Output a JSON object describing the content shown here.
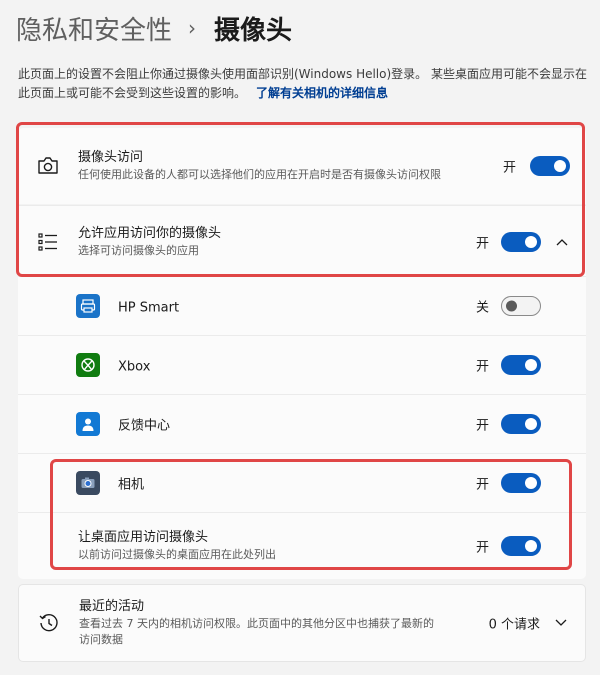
{
  "breadcrumb": {
    "parent": "隐私和安全性",
    "separator": "›",
    "current": "摄像头"
  },
  "description": {
    "text": "此页面上的设置不会阻止你通过摄像头使用面部识别(Windows Hello)登录。 某些桌面应用可能不会显示在此页面上或可能不会受到这些设置的影响。",
    "link": "了解有关相机的详细信息"
  },
  "camera_access": {
    "title": "摄像头访问",
    "subtitle": "任何使用此设备的人都可以选择他们的应用在开启时是否有摄像头访问权限",
    "state": "开",
    "icon": "camera-icon"
  },
  "app_access": {
    "title": "允许应用访问你的摄像头",
    "subtitle": "选择可访问摄像头的应用",
    "state": "开",
    "icon": "list-icon"
  },
  "apps": [
    {
      "name": "HP Smart",
      "state": "关",
      "on": false,
      "icon": "hp-smart-icon",
      "color": "#1a73c8"
    },
    {
      "name": "Xbox",
      "state": "开",
      "on": true,
      "icon": "xbox-icon",
      "color": "#107c10"
    },
    {
      "name": "反馈中心",
      "state": "开",
      "on": true,
      "icon": "feedback-hub-icon",
      "color": "#1279d4"
    },
    {
      "name": "相机",
      "state": "开",
      "on": true,
      "icon": "camera-app-icon",
      "color": "#3a4a60"
    }
  ],
  "desktop_apps": {
    "title": "让桌面应用访问摄像头",
    "subtitle": "以前访问过摄像头的桌面应用在此处列出",
    "state": "开"
  },
  "recent_activity": {
    "title": "最近的活动",
    "subtitle_line1": "查看过去 7 天内的相机访问权限。此页面中的其他分区中也捕获了最新的",
    "subtitle_line2": "访问数据",
    "count": "0 个请求",
    "icon": "history-icon"
  },
  "colors": {
    "accent": "#0a5cbf",
    "highlight": "#e04646"
  }
}
